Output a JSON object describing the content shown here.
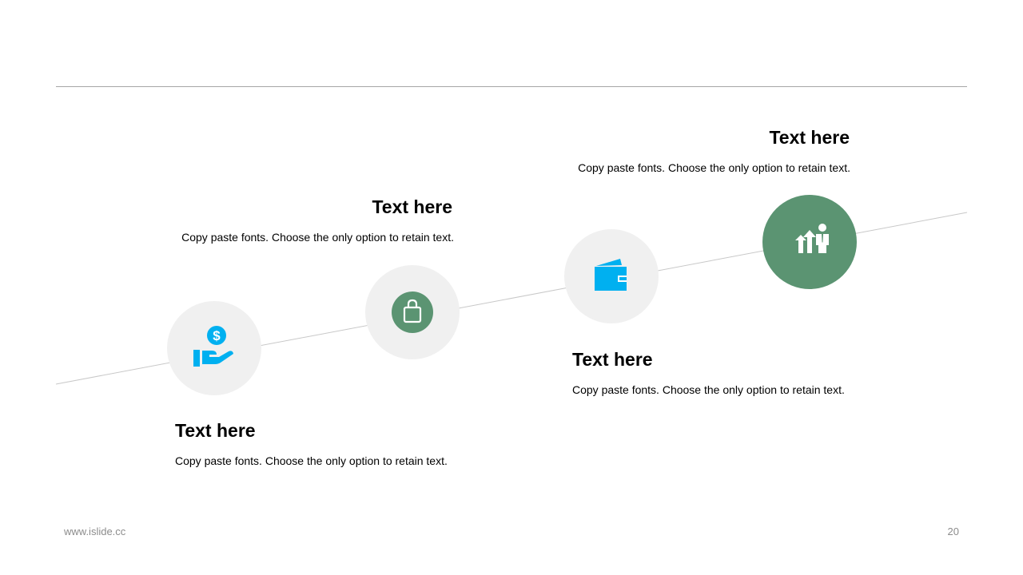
{
  "steps": [
    {
      "title": "Text here",
      "desc": "Copy paste fonts. Choose the only option to retain text.",
      "icon": "hand-coin-icon"
    },
    {
      "title": "Text here",
      "desc": "Copy paste fonts. Choose the only option to retain text.",
      "icon": "shopping-bag-icon"
    },
    {
      "title": "Text here",
      "desc": "Copy paste fonts. Choose the only option to retain text.",
      "icon": "wallet-icon"
    },
    {
      "title": "Text here",
      "desc": "Copy paste fonts. Choose the only option to retain text.",
      "icon": "growth-businessman-icon"
    }
  ],
  "colors": {
    "accent": "#5b9472",
    "blue": "#00b0f0",
    "circle": "#f0f0f0"
  },
  "footer": {
    "website": "www.islide.cc",
    "page": "20"
  }
}
